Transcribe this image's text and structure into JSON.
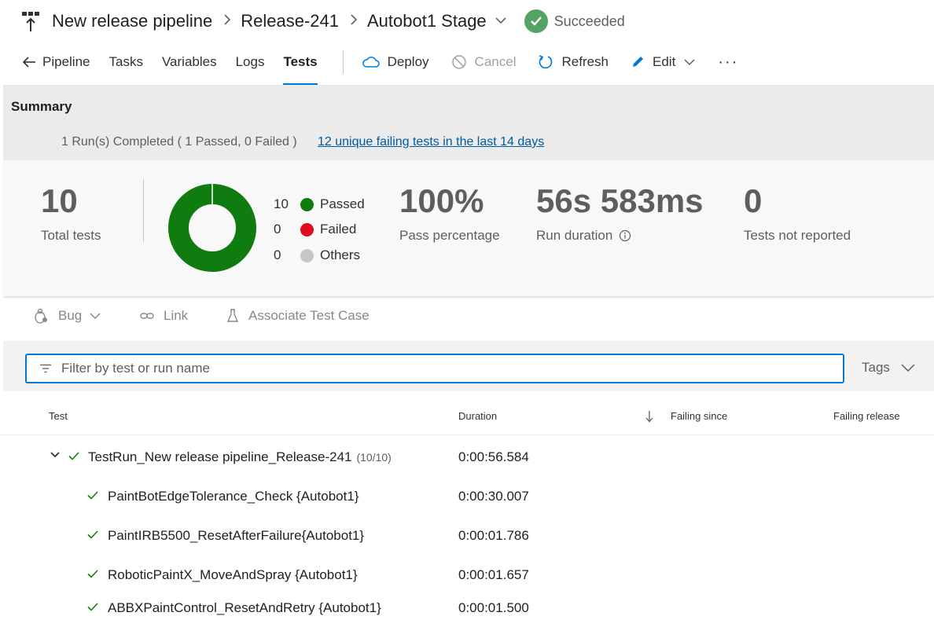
{
  "breadcrumb": {
    "pipeline": "New release pipeline",
    "release": "Release-241",
    "stage": "Autobot1 Stage",
    "status": "Succeeded"
  },
  "tabs": [
    {
      "label": "Pipeline"
    },
    {
      "label": "Tasks"
    },
    {
      "label": "Variables"
    },
    {
      "label": "Logs"
    },
    {
      "label": "Tests",
      "active": true
    }
  ],
  "commands": {
    "deploy": "Deploy",
    "cancel": "Cancel",
    "refresh": "Refresh",
    "edit": "Edit",
    "more": "···"
  },
  "summary": {
    "title": "Summary",
    "runs_completed": "1 Run(s) Completed ( 1 Passed, 0 Failed )",
    "failing_link": "12 unique failing tests in the last 14 days",
    "total_tests": "10",
    "total_tests_label": "Total tests",
    "legend": [
      {
        "count": "10",
        "label": "Passed",
        "color": "#107c10"
      },
      {
        "count": "0",
        "label": "Failed",
        "color": "#e00b1c"
      },
      {
        "count": "0",
        "label": "Others",
        "color": "#c8c6c4"
      }
    ],
    "pass_percentage": "100%",
    "pass_percentage_label": "Pass percentage",
    "run_duration": "56s 583ms",
    "run_duration_label": "Run duration",
    "not_reported": "0",
    "not_reported_label": "Tests not reported"
  },
  "toolbar": {
    "bug": "Bug",
    "link": "Link",
    "associate": "Associate Test Case"
  },
  "filter": {
    "placeholder": "Filter by test or run name",
    "tags": "Tags"
  },
  "table": {
    "headers": {
      "test": "Test",
      "duration": "Duration",
      "failing_since": "Failing since",
      "failing_release": "Failing release"
    },
    "run": {
      "name": "TestRun_New release pipeline_Release-241",
      "count": "(10/10)",
      "duration": "0:00:56.584"
    },
    "rows": [
      {
        "name": "PaintBotEdgeTolerance_Check {Autobot1}",
        "duration": "0:00:30.007"
      },
      {
        "name": "PaintIRB5500_ResetAfterFailure{Autobot1}",
        "duration": "0:00:01.786"
      },
      {
        "name": "RoboticPaintX_MoveAndSpray {Autobot1}",
        "duration": "0:00:01.657"
      },
      {
        "name": "ABBXPaintControl_ResetAndRetry {Autobot1}",
        "duration": "0:00:01.500"
      }
    ]
  },
  "colors": {
    "accent": "#0078d4",
    "success": "#55a362",
    "passed": "#107c10",
    "link": "#005a9e"
  }
}
